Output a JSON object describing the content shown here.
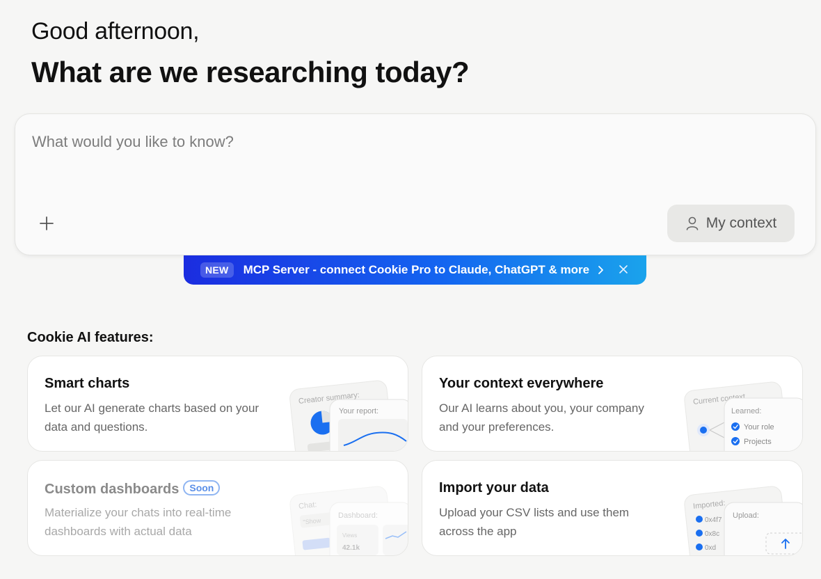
{
  "greeting": "Good afternoon,",
  "headline": "What are we researching today?",
  "prompt": {
    "placeholder": "What would you like to know?",
    "context_button": "My context"
  },
  "banner": {
    "badge": "NEW",
    "text": "MCP Server - connect Cookie Pro to Claude, ChatGPT & more"
  },
  "features": {
    "title": "Cookie AI features:",
    "cards": [
      {
        "title": "Smart charts",
        "description": "Let our AI generate charts based on your data and questions.",
        "illus_label_back": "Creator summary:",
        "illus_label_front": "Your report:"
      },
      {
        "title": "Your context everywhere",
        "description": "Our AI learns about you, your company and your preferences.",
        "illus_label_back": "Current context",
        "illus_label_front": "Learned:",
        "illus_items": [
          "Your role",
          "Projects"
        ]
      },
      {
        "title": "Custom dashboards",
        "badge": "Soon",
        "description": "Materialize your chats into real-time dashboards with actual data",
        "illus_label_back": "Chat:",
        "illus_chat_text": "\"Show",
        "illus_label_front": "Dashboard:",
        "illus_stat_label": "Views",
        "illus_stat_value": "42.1k"
      },
      {
        "title": "Import your data",
        "description": "Upload your CSV lists and use them across the app",
        "illus_label_back": "Imported:",
        "illus_label_front": "Upload:",
        "illus_items": [
          "0x4f7",
          "0x8c",
          "0xd"
        ]
      }
    ]
  },
  "colors": {
    "background": "#f6f6f5",
    "banner_start": "#1b2de0",
    "banner_end": "#1aa3ec",
    "accent_blue": "#1a6ff0",
    "soon_badge": "#5a8fe8"
  }
}
